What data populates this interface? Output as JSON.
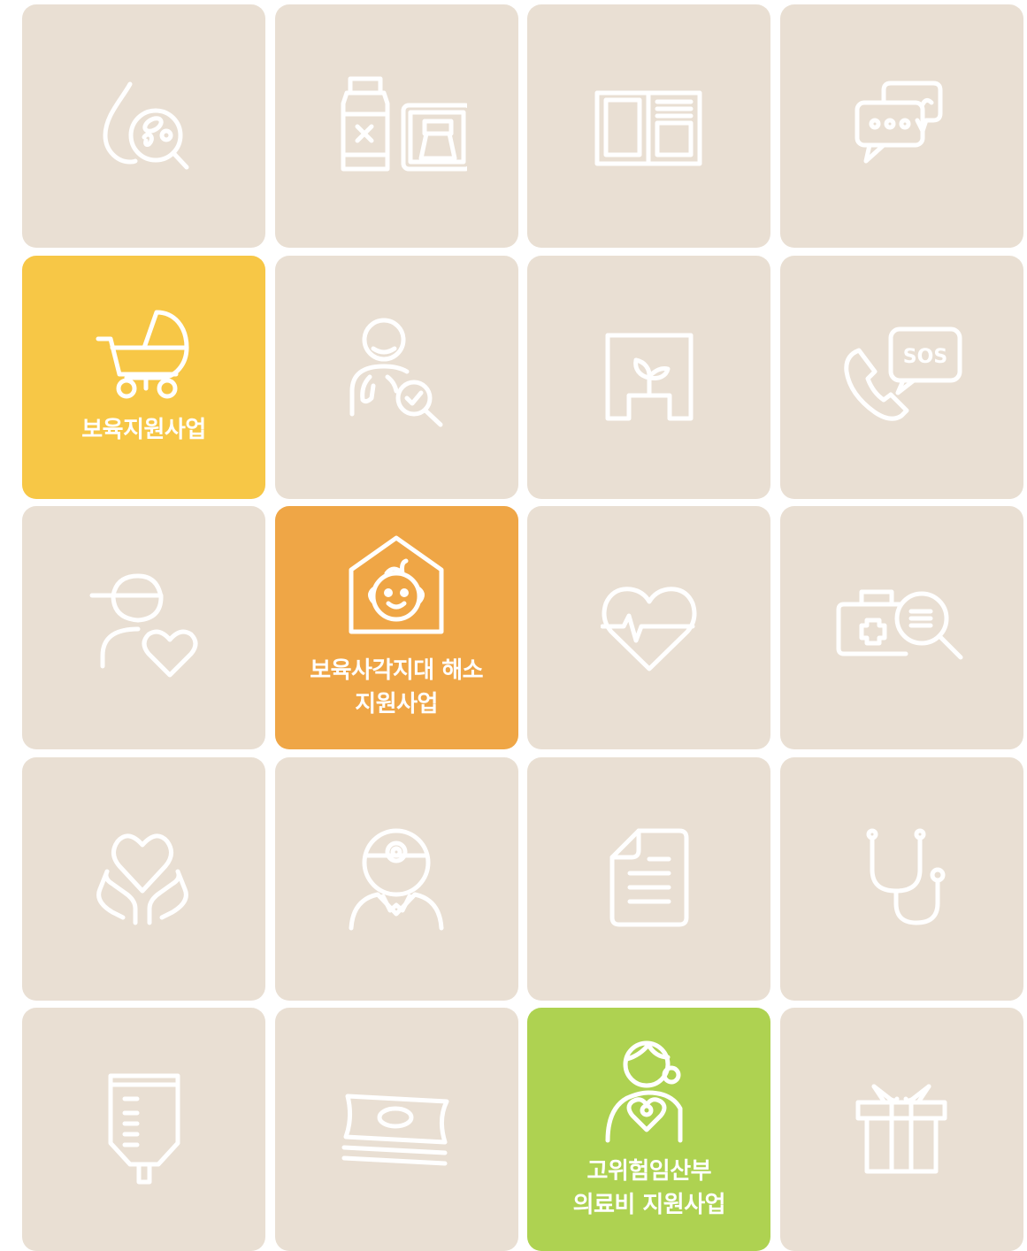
{
  "tiles": [
    {
      "icon": "blood-drop-magnifier-icon",
      "label": []
    },
    {
      "icon": "medicine-bottle-frame-icon",
      "label": []
    },
    {
      "icon": "open-book-icon",
      "label": []
    },
    {
      "icon": "chat-bubbles-icon",
      "label": []
    },
    {
      "icon": "baby-stroller-icon",
      "label": [
        "보육지원사업"
      ]
    },
    {
      "icon": "person-lungs-check-icon",
      "label": []
    },
    {
      "icon": "sprout-house-icon",
      "label": []
    },
    {
      "icon": "phone-sos-icon",
      "label": []
    },
    {
      "icon": "kid-heart-icon",
      "label": []
    },
    {
      "icon": "baby-house-icon",
      "label": [
        "보육사각지대 해소",
        "지원사업"
      ]
    },
    {
      "icon": "heartbeat-icon",
      "label": []
    },
    {
      "icon": "first-aid-kit-search-icon",
      "label": []
    },
    {
      "icon": "hands-heart-icon",
      "label": []
    },
    {
      "icon": "doctor-icon",
      "label": []
    },
    {
      "icon": "document-icon",
      "label": []
    },
    {
      "icon": "stethoscope-icon",
      "label": []
    },
    {
      "icon": "iv-bag-icon",
      "label": []
    },
    {
      "icon": "money-stack-icon",
      "label": []
    },
    {
      "icon": "pregnant-woman-icon",
      "label": [
        "고위험임산부",
        "의료비 지원사업"
      ]
    },
    {
      "icon": "gift-box-icon",
      "label": []
    }
  ],
  "sos_text": "SOS",
  "colors": {
    "tile_default": "#e9dfd3",
    "tile_childcare": "#f7c746",
    "tile_blindspot": "#efa646",
    "tile_pregnancy": "#aed251",
    "icon": "#ffffff"
  }
}
